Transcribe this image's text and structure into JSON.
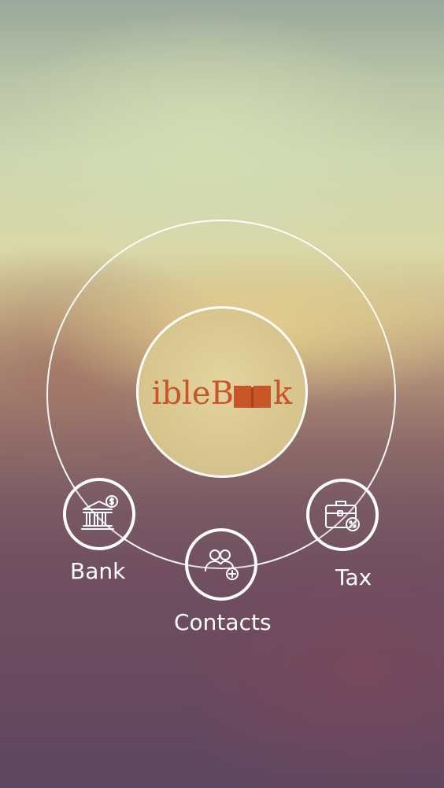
{
  "app": {
    "logo": {
      "text_prefix": "ible",
      "text_b": "B",
      "text_suffix": "k",
      "color": "#c75525"
    }
  },
  "menu": {
    "items": [
      {
        "id": "bank",
        "label": "Bank",
        "icon": "bank-icon"
      },
      {
        "id": "contacts",
        "label": "Contacts",
        "icon": "add-contacts-icon"
      },
      {
        "id": "tax",
        "label": "Tax",
        "icon": "tax-briefcase-icon"
      }
    ],
    "ring_color": "#ffffff"
  }
}
